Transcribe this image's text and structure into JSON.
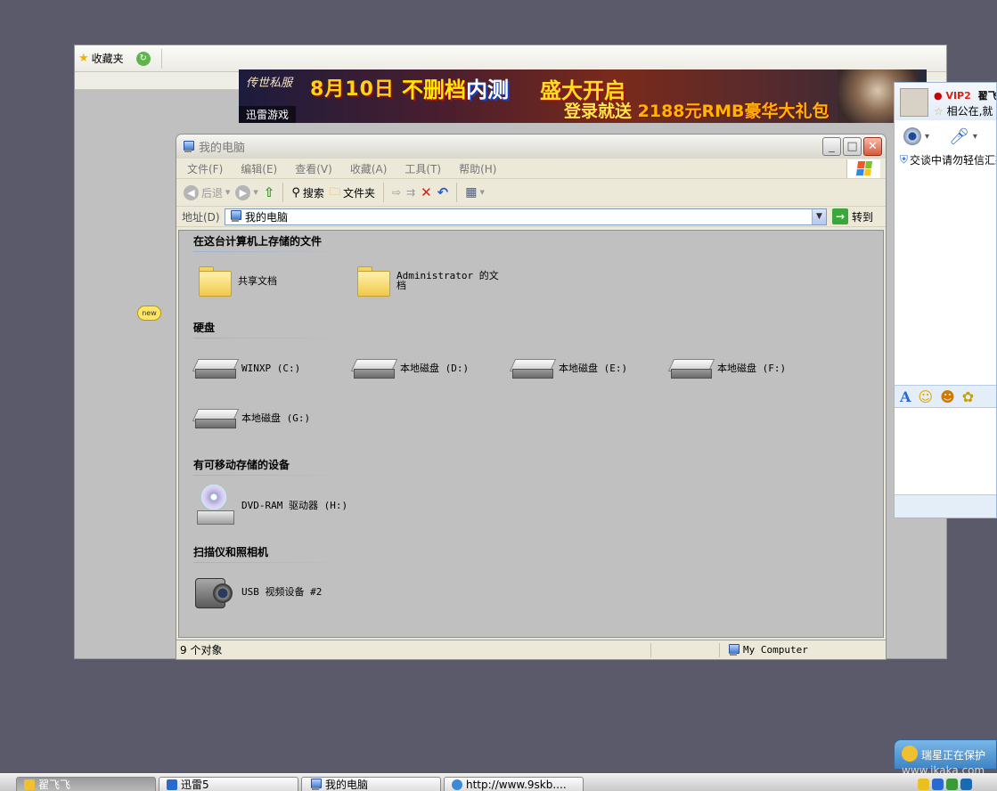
{
  "background_window": {
    "favorites_label": "收藏夹"
  },
  "banner": {
    "logo": "传世私服",
    "date_text": "8月10日",
    "headline_a": "不删档",
    "headline_b": "内测",
    "headline_c": "盛大开启",
    "promo": "登录就送",
    "promo_amount": "2188元RMB豪华大礼包",
    "source_tag": "迅雷游戏"
  },
  "new_badge": "new",
  "qq_chat": {
    "vip_label": "VIP2",
    "contact_name": "翟飞飞",
    "signature": "相公在,就",
    "warning": "交谈中请勿轻信汇款"
  },
  "explorer": {
    "title": "我的电脑",
    "menu": [
      "文件(F)",
      "编辑(E)",
      "查看(V)",
      "收藏(A)",
      "工具(T)",
      "帮助(H)"
    ],
    "toolbar": {
      "back": "后退",
      "search": "搜索",
      "folders": "文件夹"
    },
    "address": {
      "label": "地址(D)",
      "value": "我的电脑",
      "go": "转到"
    },
    "groups": {
      "stored_files": "在这台计算机上存储的文件",
      "hard_disks": "硬盘",
      "removable": "有可移动存储的设备",
      "scanners": "扫描仪和照相机"
    },
    "items": {
      "shared_docs": "共享文档",
      "admin_docs": "Administrator 的文档",
      "drive_c": "WINXP (C:)",
      "drive_d": "本地磁盘 (D:)",
      "drive_e": "本地磁盘 (E:)",
      "drive_f": "本地磁盘 (F:)",
      "drive_g": "本地磁盘 (G:)",
      "dvd": "DVD-RAM 驱动器 (H:)",
      "usb_cam": "USB 视频设备 #2"
    },
    "status": {
      "count": "9 个对象",
      "location": "My Computer"
    }
  },
  "taskbar": {
    "tasks": [
      "翟飞飞",
      "迅雷5",
      "我的电脑",
      "http://www.9skb...."
    ]
  },
  "rising": {
    "text": "瑞星正在保护"
  },
  "watermark": "www.jkaka.com",
  "colors": {
    "desktop": "#5a5a6a",
    "content_bg": "#c0c0c0",
    "chrome": "#ece9d8",
    "close_button": "#d8583c"
  }
}
